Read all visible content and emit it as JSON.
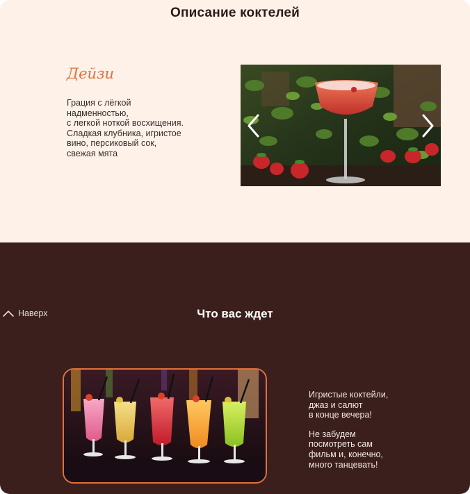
{
  "colors": {
    "top_background": "#fdf1e8",
    "bottom_background": "#3a1f1d",
    "accent": "#e0703a",
    "dark_text": "#2b1a18",
    "light_text": "#f2e7e2"
  },
  "description_section": {
    "title": "Описание коктелей",
    "cocktail": {
      "name": "Дейзи",
      "description": "Грация с лёгкой\nнадменностью,\nс легкой ноткой восхищения.\nСладкая клубника, игристое\nвино, персиковый сок,\nсвежая мята"
    },
    "slider": {
      "image": "cocktail-photo",
      "prev_icon": "chevron-left-icon",
      "next_icon": "chevron-right-icon"
    }
  },
  "expect_section": {
    "back_to_top": {
      "icon": "chevron-up-icon",
      "label": "Наверх"
    },
    "title": "Что вас ждет",
    "photo": "cocktails-photo",
    "paragraphs": [
      "Игристые коктейли,\nджаз и салют\nв конце вечера!",
      "Не забудем\nпосмотреть сам\nфильм и, конечно,\nмного танцевать!"
    ]
  }
}
